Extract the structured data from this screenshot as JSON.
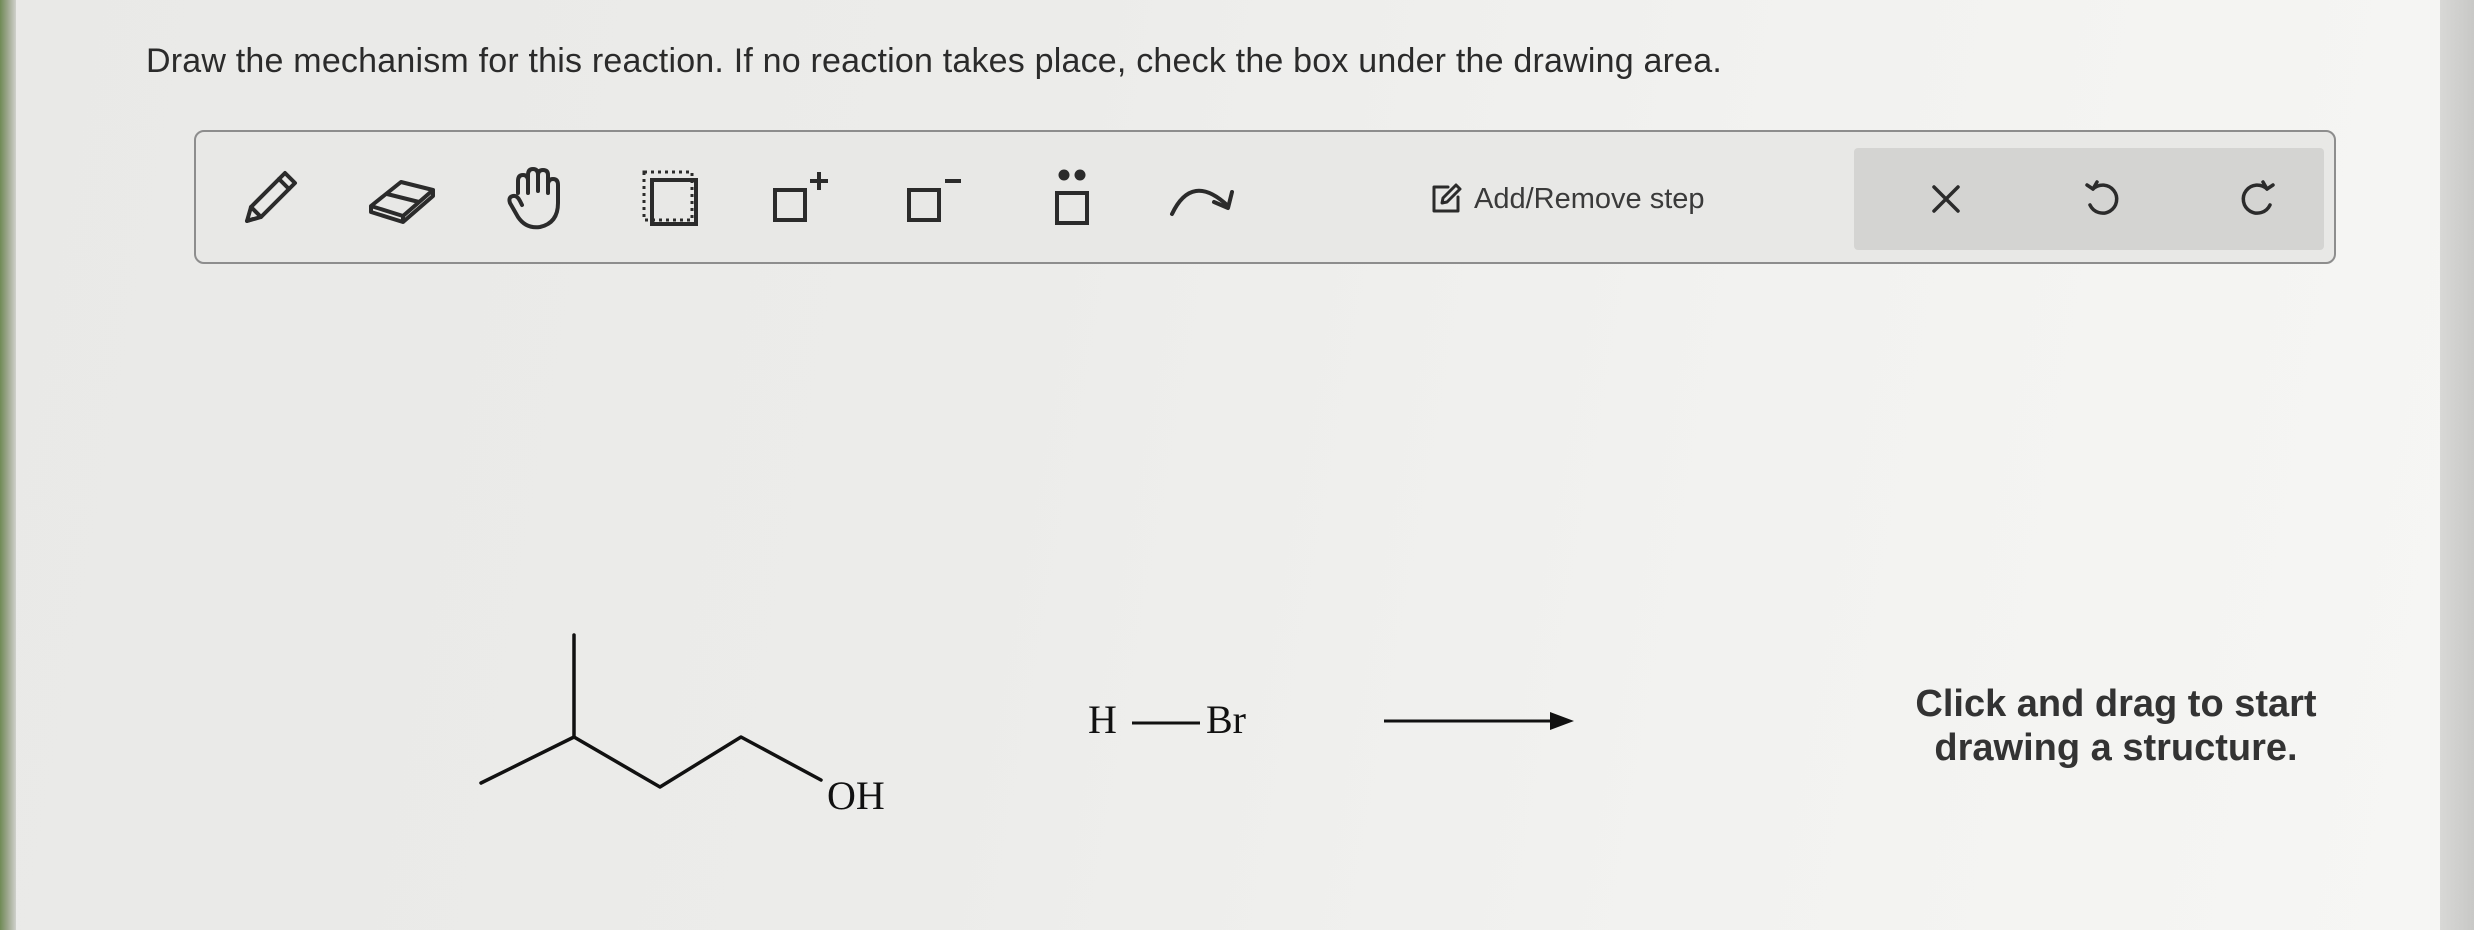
{
  "prompt": "Draw the mechanism for this reaction. If no reaction takes place, check the box under the drawing area.",
  "toolbar": {
    "tools": [
      {
        "name": "pencil-tool",
        "icon": "pencil-icon"
      },
      {
        "name": "eraser-tool",
        "icon": "eraser-icon"
      },
      {
        "name": "hand-tool",
        "icon": "hand-icon"
      },
      {
        "name": "selection-tool",
        "icon": "dotted-selection-icon"
      },
      {
        "name": "positive-charge-tool",
        "icon": "square-plus-charge-icon"
      },
      {
        "name": "negative-charge-tool",
        "icon": "square-minus-charge-icon"
      },
      {
        "name": "lone-pair-tool",
        "icon": "square-lone-pair-icon"
      },
      {
        "name": "curved-arrow-tool",
        "icon": "curved-arrow-icon"
      }
    ],
    "step_label": "Add/Remove step",
    "actions": [
      {
        "name": "clear-button",
        "icon": "close-icon"
      },
      {
        "name": "undo-button",
        "icon": "undo-icon"
      },
      {
        "name": "redo-button",
        "icon": "redo-icon"
      }
    ]
  },
  "reaction": {
    "reactant_group": "OH",
    "reagent_h": "H",
    "reagent_br": "Br"
  },
  "hint": {
    "line1": "Click and drag to start",
    "line2": "drawing a structure."
  }
}
